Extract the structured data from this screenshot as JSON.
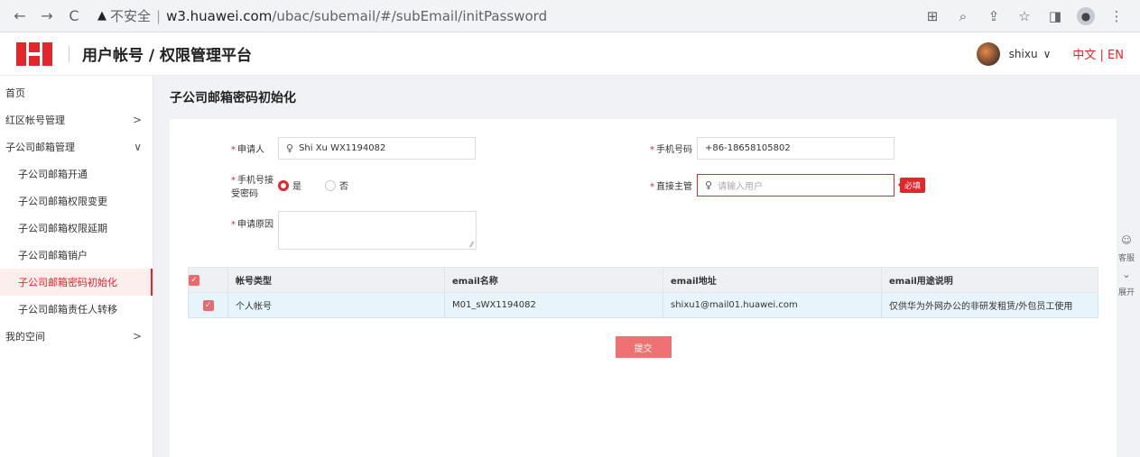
{
  "browser": {
    "back": "←",
    "forward": "→",
    "reload": "C",
    "insecure_label": "不安全",
    "url_host": "w3.huawei.com",
    "url_path": "/ubac/subemail/#/subEmail/initPassword"
  },
  "header": {
    "title": "用户帐号 / 权限管理平台",
    "user": "shixu",
    "lang_zh": "中文",
    "lang_sep": " | ",
    "lang_en": "EN"
  },
  "sidebar": {
    "items": [
      {
        "label": "首页"
      },
      {
        "label": "红区帐号管理",
        "arrow": ">"
      },
      {
        "label": "子公司邮箱管理",
        "arrow": "∨"
      },
      {
        "label": "子公司邮箱开通"
      },
      {
        "label": "子公司邮箱权限变更"
      },
      {
        "label": "子公司邮箱权限延期"
      },
      {
        "label": "子公司邮箱销户"
      },
      {
        "label": "子公司邮箱密码初始化"
      },
      {
        "label": "子公司邮箱责任人转移"
      },
      {
        "label": "我的空间",
        "arrow": ">"
      }
    ]
  },
  "page": {
    "title": "子公司邮箱密码初始化"
  },
  "form": {
    "applicant_label": "申请人",
    "applicant_value": "Shi Xu WX1194082",
    "phone_label": "手机号码",
    "phone_value": "+86-18658105802",
    "phone_receive_label": "手机号接受密码",
    "radio_yes": "是",
    "radio_no": "否",
    "manager_label": "直接主管",
    "manager_placeholder": "请输入用户",
    "required_badge": "必填",
    "reason_label": "申请原因"
  },
  "table": {
    "headers": [
      "帐号类型",
      "email名称",
      "email地址",
      "email用途说明"
    ],
    "rows": [
      [
        "个人帐号",
        "M01_sWX1194082",
        "shixu1@mail01.huawei.com",
        "仅供华为外网办公的非研发租赁/外包员工使用"
      ]
    ]
  },
  "submit_label": "提交",
  "float_tools": {
    "service": "客服",
    "expand": "展开"
  }
}
